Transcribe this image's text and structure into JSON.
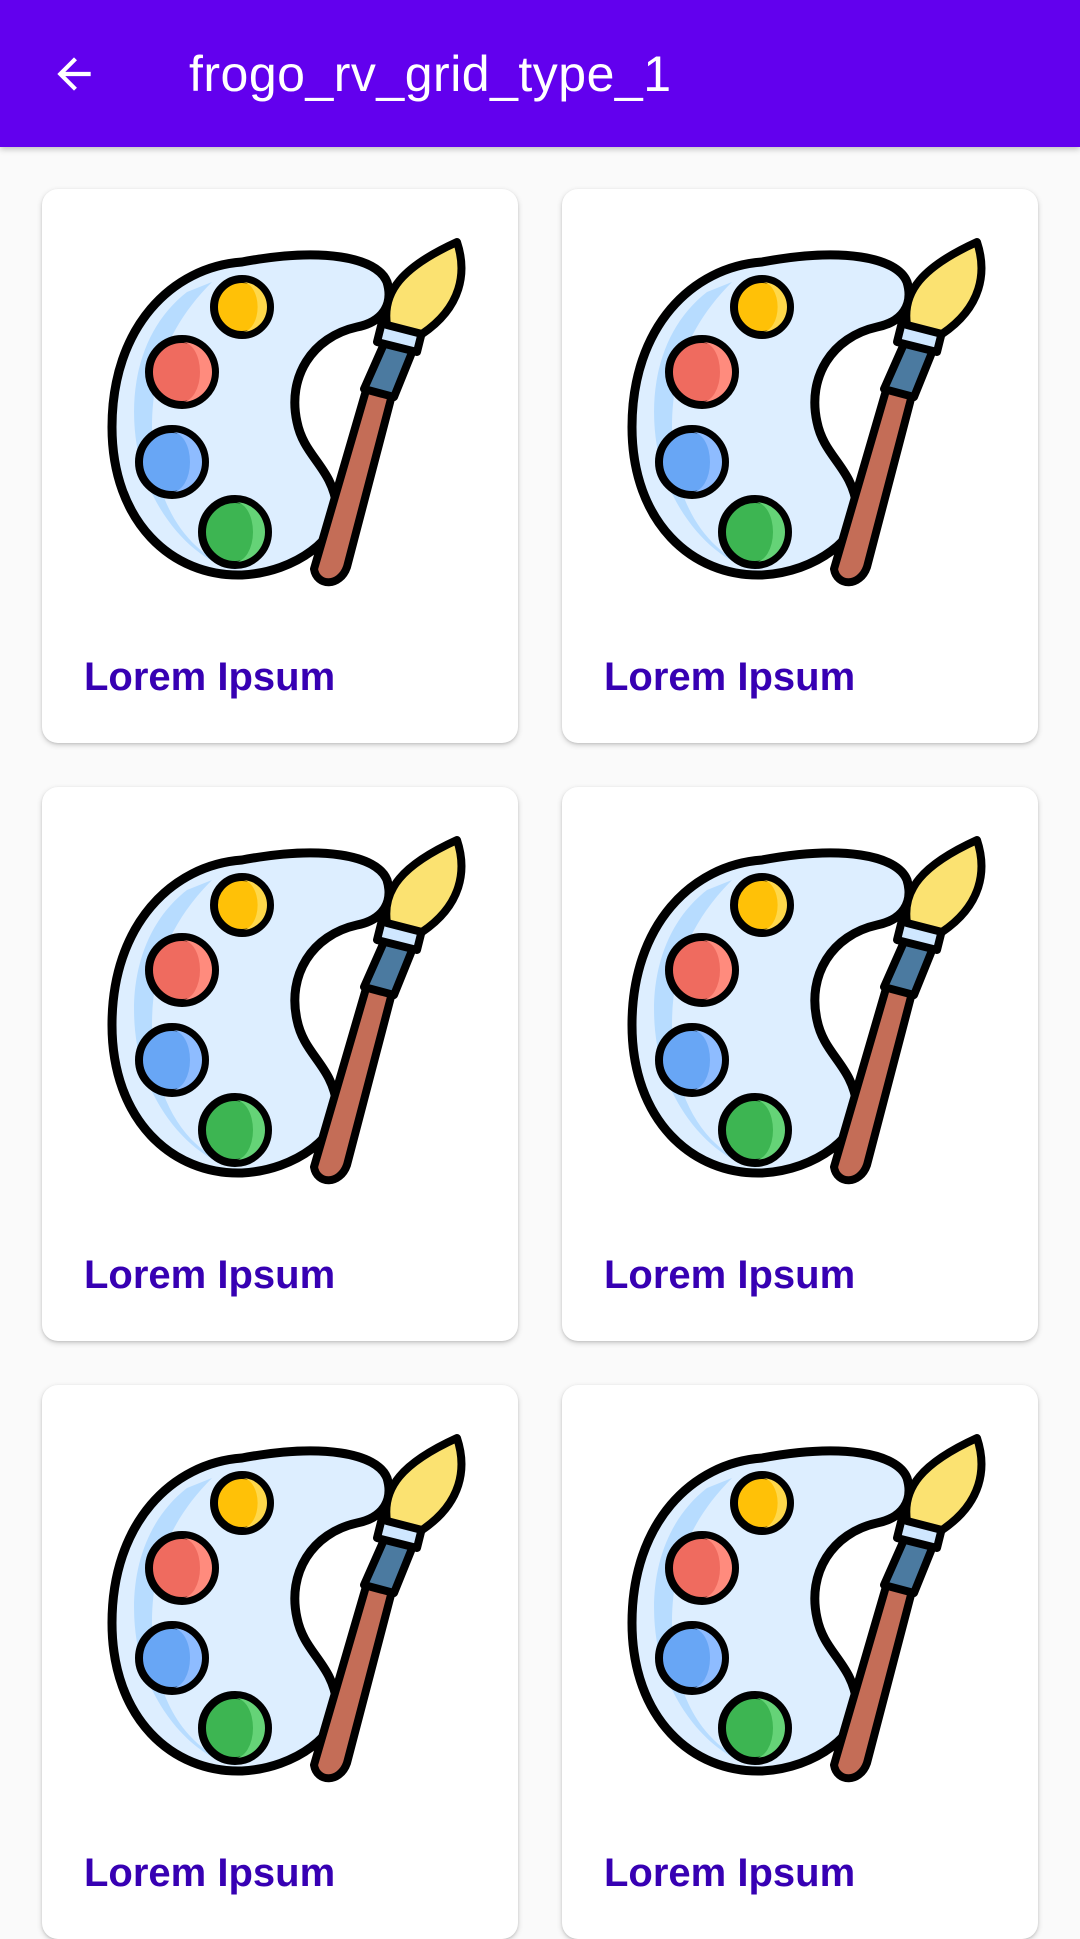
{
  "app_bar": {
    "title": "frogo_rv_grid_type_1",
    "back_icon": "arrow-back-icon",
    "color": "#6200ee"
  },
  "grid": {
    "items": [
      {
        "label": "Lorem Ipsum",
        "icon": "paint-palette-icon"
      },
      {
        "label": "Lorem Ipsum",
        "icon": "paint-palette-icon"
      },
      {
        "label": "Lorem Ipsum",
        "icon": "paint-palette-icon"
      },
      {
        "label": "Lorem Ipsum",
        "icon": "paint-palette-icon"
      },
      {
        "label": "Lorem Ipsum",
        "icon": "paint-palette-icon"
      },
      {
        "label": "Lorem Ipsum",
        "icon": "paint-palette-icon"
      }
    ],
    "label_color": "#3700b3"
  }
}
